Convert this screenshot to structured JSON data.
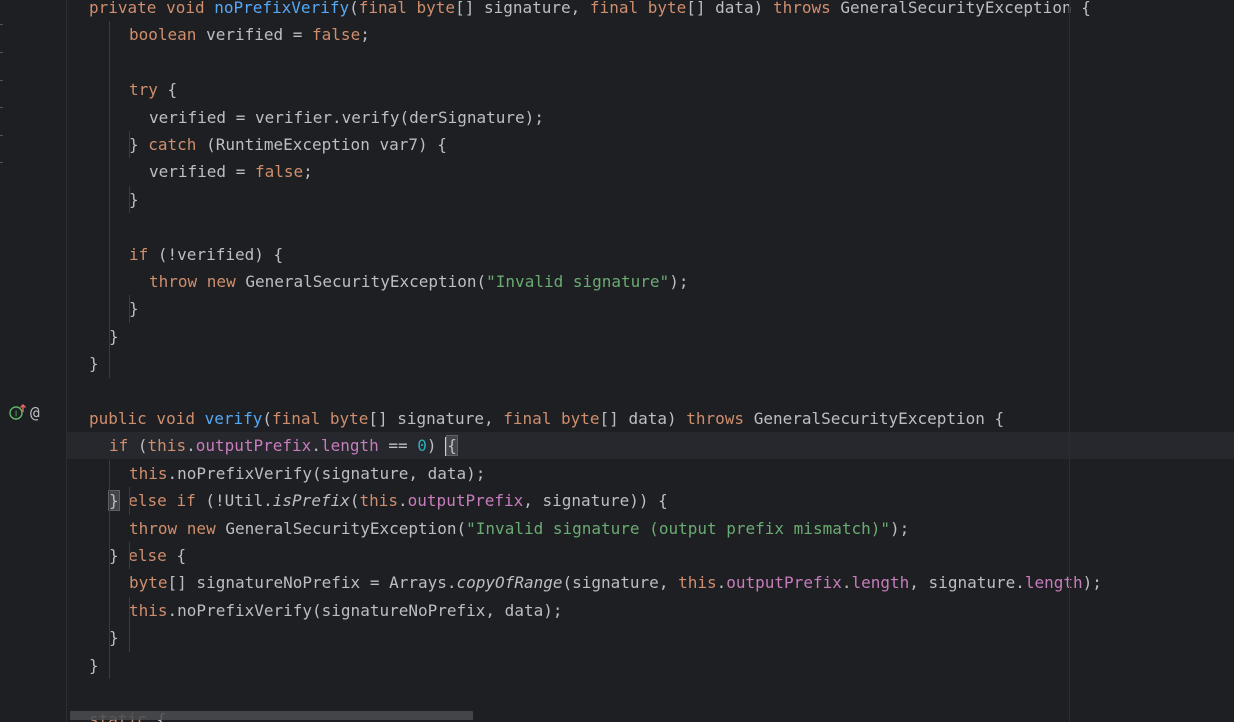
{
  "editor": {
    "lines": [
      {
        "id": "l1",
        "indent": 1,
        "tokens": [
          [
            "kw",
            "private void "
          ],
          [
            "fn",
            "noPrefixVerify"
          ],
          [
            "",
            "("
          ],
          [
            "kw",
            "final byte"
          ],
          [
            "",
            "[] signature, "
          ],
          [
            "kw",
            "final byte"
          ],
          [
            "",
            "[] data) "
          ],
          [
            "kw",
            "throws "
          ],
          [
            "",
            "GeneralSecurityException {"
          ]
        ]
      },
      {
        "id": "l2",
        "indent": 3,
        "tokens": [
          [
            "kw",
            "boolean "
          ],
          [
            "",
            "verified = "
          ],
          [
            "kw",
            "false"
          ],
          [
            "",
            ";"
          ]
        ]
      },
      {
        "id": "l3",
        "indent": 0,
        "tokens": []
      },
      {
        "id": "l4",
        "indent": 3,
        "tokens": [
          [
            "kw",
            "try "
          ],
          [
            "",
            "{"
          ]
        ]
      },
      {
        "id": "l5",
        "indent": 4,
        "tokens": [
          [
            "",
            "verified = verifier.verify(derSignature);"
          ]
        ]
      },
      {
        "id": "l6",
        "indent": 3,
        "tokens": [
          [
            "",
            "} "
          ],
          [
            "kw",
            "catch "
          ],
          [
            "",
            "(RuntimeException var7) {"
          ]
        ]
      },
      {
        "id": "l7",
        "indent": 4,
        "tokens": [
          [
            "",
            "verified = "
          ],
          [
            "kw",
            "false"
          ],
          [
            "",
            ";"
          ]
        ]
      },
      {
        "id": "l8",
        "indent": 3,
        "tokens": [
          [
            "",
            "}"
          ]
        ]
      },
      {
        "id": "l9",
        "indent": 0,
        "tokens": []
      },
      {
        "id": "l10",
        "indent": 3,
        "tokens": [
          [
            "kw",
            "if "
          ],
          [
            "",
            "(!verified) {"
          ]
        ]
      },
      {
        "id": "l11",
        "indent": 4,
        "tokens": [
          [
            "kw",
            "throw new "
          ],
          [
            "",
            "GeneralSecurityException("
          ],
          [
            "str",
            "\"Invalid signature\""
          ],
          [
            "",
            ");"
          ]
        ]
      },
      {
        "id": "l12",
        "indent": 3,
        "tokens": [
          [
            "",
            "}"
          ]
        ]
      },
      {
        "id": "l13",
        "indent": 2,
        "tokens": [
          [
            "",
            "}"
          ]
        ]
      },
      {
        "id": "l14",
        "indent": 1,
        "tokens": [
          [
            "",
            "}"
          ]
        ]
      },
      {
        "id": "l15",
        "indent": 0,
        "tokens": []
      },
      {
        "id": "l16",
        "indent": 1,
        "tokens": [
          [
            "kw",
            "public void "
          ],
          [
            "fn",
            "verify"
          ],
          [
            "",
            "("
          ],
          [
            "kw",
            "final byte"
          ],
          [
            "",
            "[] signature, "
          ],
          [
            "kw",
            "final byte"
          ],
          [
            "",
            "[] data) "
          ],
          [
            "kw",
            "throws "
          ],
          [
            "",
            "GeneralSecurityException {"
          ]
        ]
      },
      {
        "id": "l17",
        "indent": 2,
        "current": true,
        "tokens": [
          [
            "kw",
            "if "
          ],
          [
            "",
            "("
          ],
          [
            "kw",
            "this"
          ],
          [
            "",
            "."
          ],
          [
            "fld",
            "outputPrefix"
          ],
          [
            "",
            "."
          ],
          [
            "fld",
            "length"
          ],
          [
            "",
            " == "
          ],
          [
            "num",
            "0"
          ],
          [
            "",
            ") "
          ],
          [
            "caret",
            ""
          ],
          [
            "bracehl",
            "{"
          ]
        ]
      },
      {
        "id": "l18",
        "indent": 3,
        "tokens": [
          [
            "kw",
            "this"
          ],
          [
            "",
            ".noPrefixVerify(signature, data);"
          ]
        ]
      },
      {
        "id": "l19",
        "indent": 2,
        "tokens": [
          [
            "bracehl",
            "}"
          ],
          [
            "kw",
            " else if "
          ],
          [
            "",
            "(!Util."
          ],
          [
            "it",
            "isPrefix"
          ],
          [
            "",
            "("
          ],
          [
            "kw",
            "this"
          ],
          [
            "",
            "."
          ],
          [
            "fld",
            "outputPrefix"
          ],
          [
            "",
            ", signature)) {"
          ]
        ]
      },
      {
        "id": "l20",
        "indent": 3,
        "tokens": [
          [
            "kw",
            "throw new "
          ],
          [
            "",
            "GeneralSecurityException("
          ],
          [
            "str",
            "\"Invalid signature (output prefix mismatch)\""
          ],
          [
            "",
            ");"
          ]
        ]
      },
      {
        "id": "l21",
        "indent": 2,
        "tokens": [
          [
            "",
            "} "
          ],
          [
            "kw",
            "else "
          ],
          [
            "",
            "{"
          ]
        ]
      },
      {
        "id": "l22",
        "indent": 3,
        "tokens": [
          [
            "kw",
            "byte"
          ],
          [
            "",
            "[] signatureNoPrefix = Arrays."
          ],
          [
            "it",
            "copyOfRange"
          ],
          [
            "",
            "(signature, "
          ],
          [
            "kw",
            "this"
          ],
          [
            "",
            "."
          ],
          [
            "fld",
            "outputPrefix"
          ],
          [
            "",
            "."
          ],
          [
            "fld",
            "length"
          ],
          [
            "",
            ", signature."
          ],
          [
            "fld",
            "length"
          ],
          [
            "",
            ");"
          ]
        ]
      },
      {
        "id": "l23",
        "indent": 3,
        "tokens": [
          [
            "kw",
            "this"
          ],
          [
            "",
            ".noPrefixVerify(signatureNoPrefix, data);"
          ]
        ]
      },
      {
        "id": "l24",
        "indent": 2,
        "tokens": [
          [
            "",
            "}"
          ]
        ]
      },
      {
        "id": "l25",
        "indent": 1,
        "tokens": [
          [
            "",
            "}"
          ]
        ]
      },
      {
        "id": "l26",
        "indent": 0,
        "tokens": []
      },
      {
        "id": "l27",
        "indent": 1,
        "tokens": [
          [
            "kw",
            "static "
          ],
          [
            "",
            "{"
          ]
        ]
      }
    ]
  },
  "gutter": {
    "override_icon": "implements-override-icon",
    "annotation_icon": "@"
  },
  "colors": {
    "background": "#1e1f22",
    "keyword": "#cf8e6d",
    "function": "#56a8f5",
    "field": "#c77dbb",
    "string": "#6aab73",
    "number": "#2aacb8"
  }
}
